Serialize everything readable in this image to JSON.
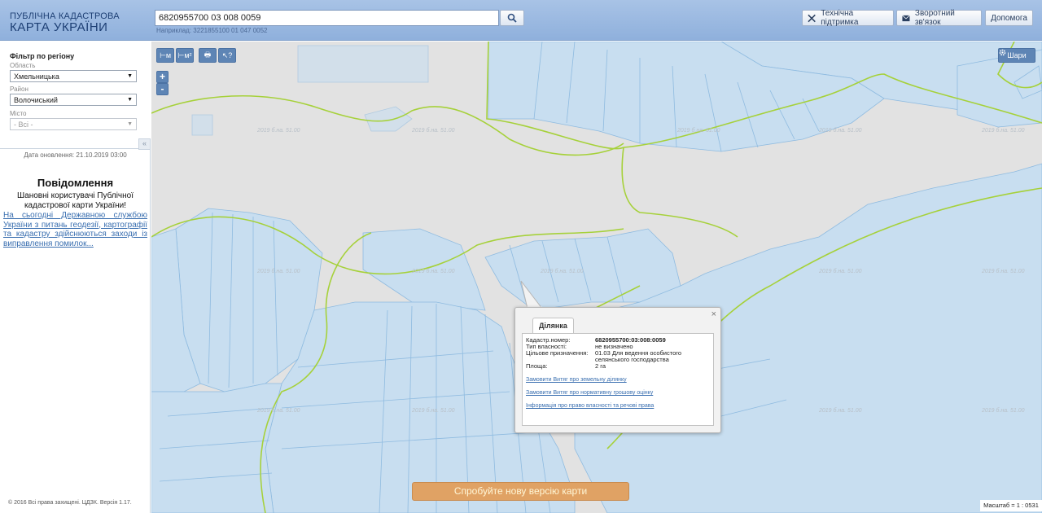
{
  "header": {
    "brand_line1": "ПУБЛІЧНА КАДАСТРОВА",
    "brand_line2": "КАРТА УКРАЇНИ",
    "search_value": "6820955700 03 008 0059",
    "search_hint": "Наприклад: 3221855100 01 047 0052",
    "support_label": "Технічна підтримка",
    "feedback_label": "Зворотний зв'язок",
    "help_label": "Допомога"
  },
  "sidebar": {
    "filter_title": "Фільтр по регіону",
    "region_label": "Область",
    "region_value": "Хмельницька",
    "district_label": "Район",
    "district_value": "Волочиський",
    "city_label": "Місто",
    "city_value": "- Всі -",
    "collapse_symbol": "«",
    "updated": "Дата оновлення: 21.10.2019 03:00",
    "notice_title": "Повідомлення",
    "notice_text": "Шановні користувачі Публічної кадастрової карти України!",
    "notice_link": "На сьогодні Державною службою України з питань геодезії, картографії та кадастру здійснюються заходи із виправлення помилок...",
    "copyright": "© 2016 Всі права захищені. ЦДЗК. Версія 1.17."
  },
  "map": {
    "tools": [
      "⊢м",
      "⊢м²",
      "🖶",
      "↖?"
    ],
    "zoom_in": "+",
    "zoom_out": "-",
    "layers_label": "Шари",
    "watermark": "2019 б.на. 51.00",
    "new_version": "Спробуйте нову версію карти",
    "scale": "Масштаб = 1 : 0531",
    "colors": {
      "parcel": "#c8def0",
      "parcel_stroke": "#8fbbe0",
      "boundary": "#a6d13a",
      "background": "#e2e2e2"
    }
  },
  "popup": {
    "tab": "Ділянка",
    "close": "×",
    "rows": [
      {
        "label": "Кадастр.номер:",
        "value": "6820955700:03:008:0059"
      },
      {
        "label": "Тип власності:",
        "value": "не визначено"
      },
      {
        "label": "Цільове призначення:",
        "value": "01.03 Для ведення особистого селянського господарства"
      },
      {
        "label": "Площа:",
        "value": "2 га"
      }
    ],
    "links": [
      "Замовити Витяг про земельну ділянку",
      "Замовити Витяг про нормативну грошову оцінку",
      "Інформація про право власності та речові права"
    ]
  }
}
